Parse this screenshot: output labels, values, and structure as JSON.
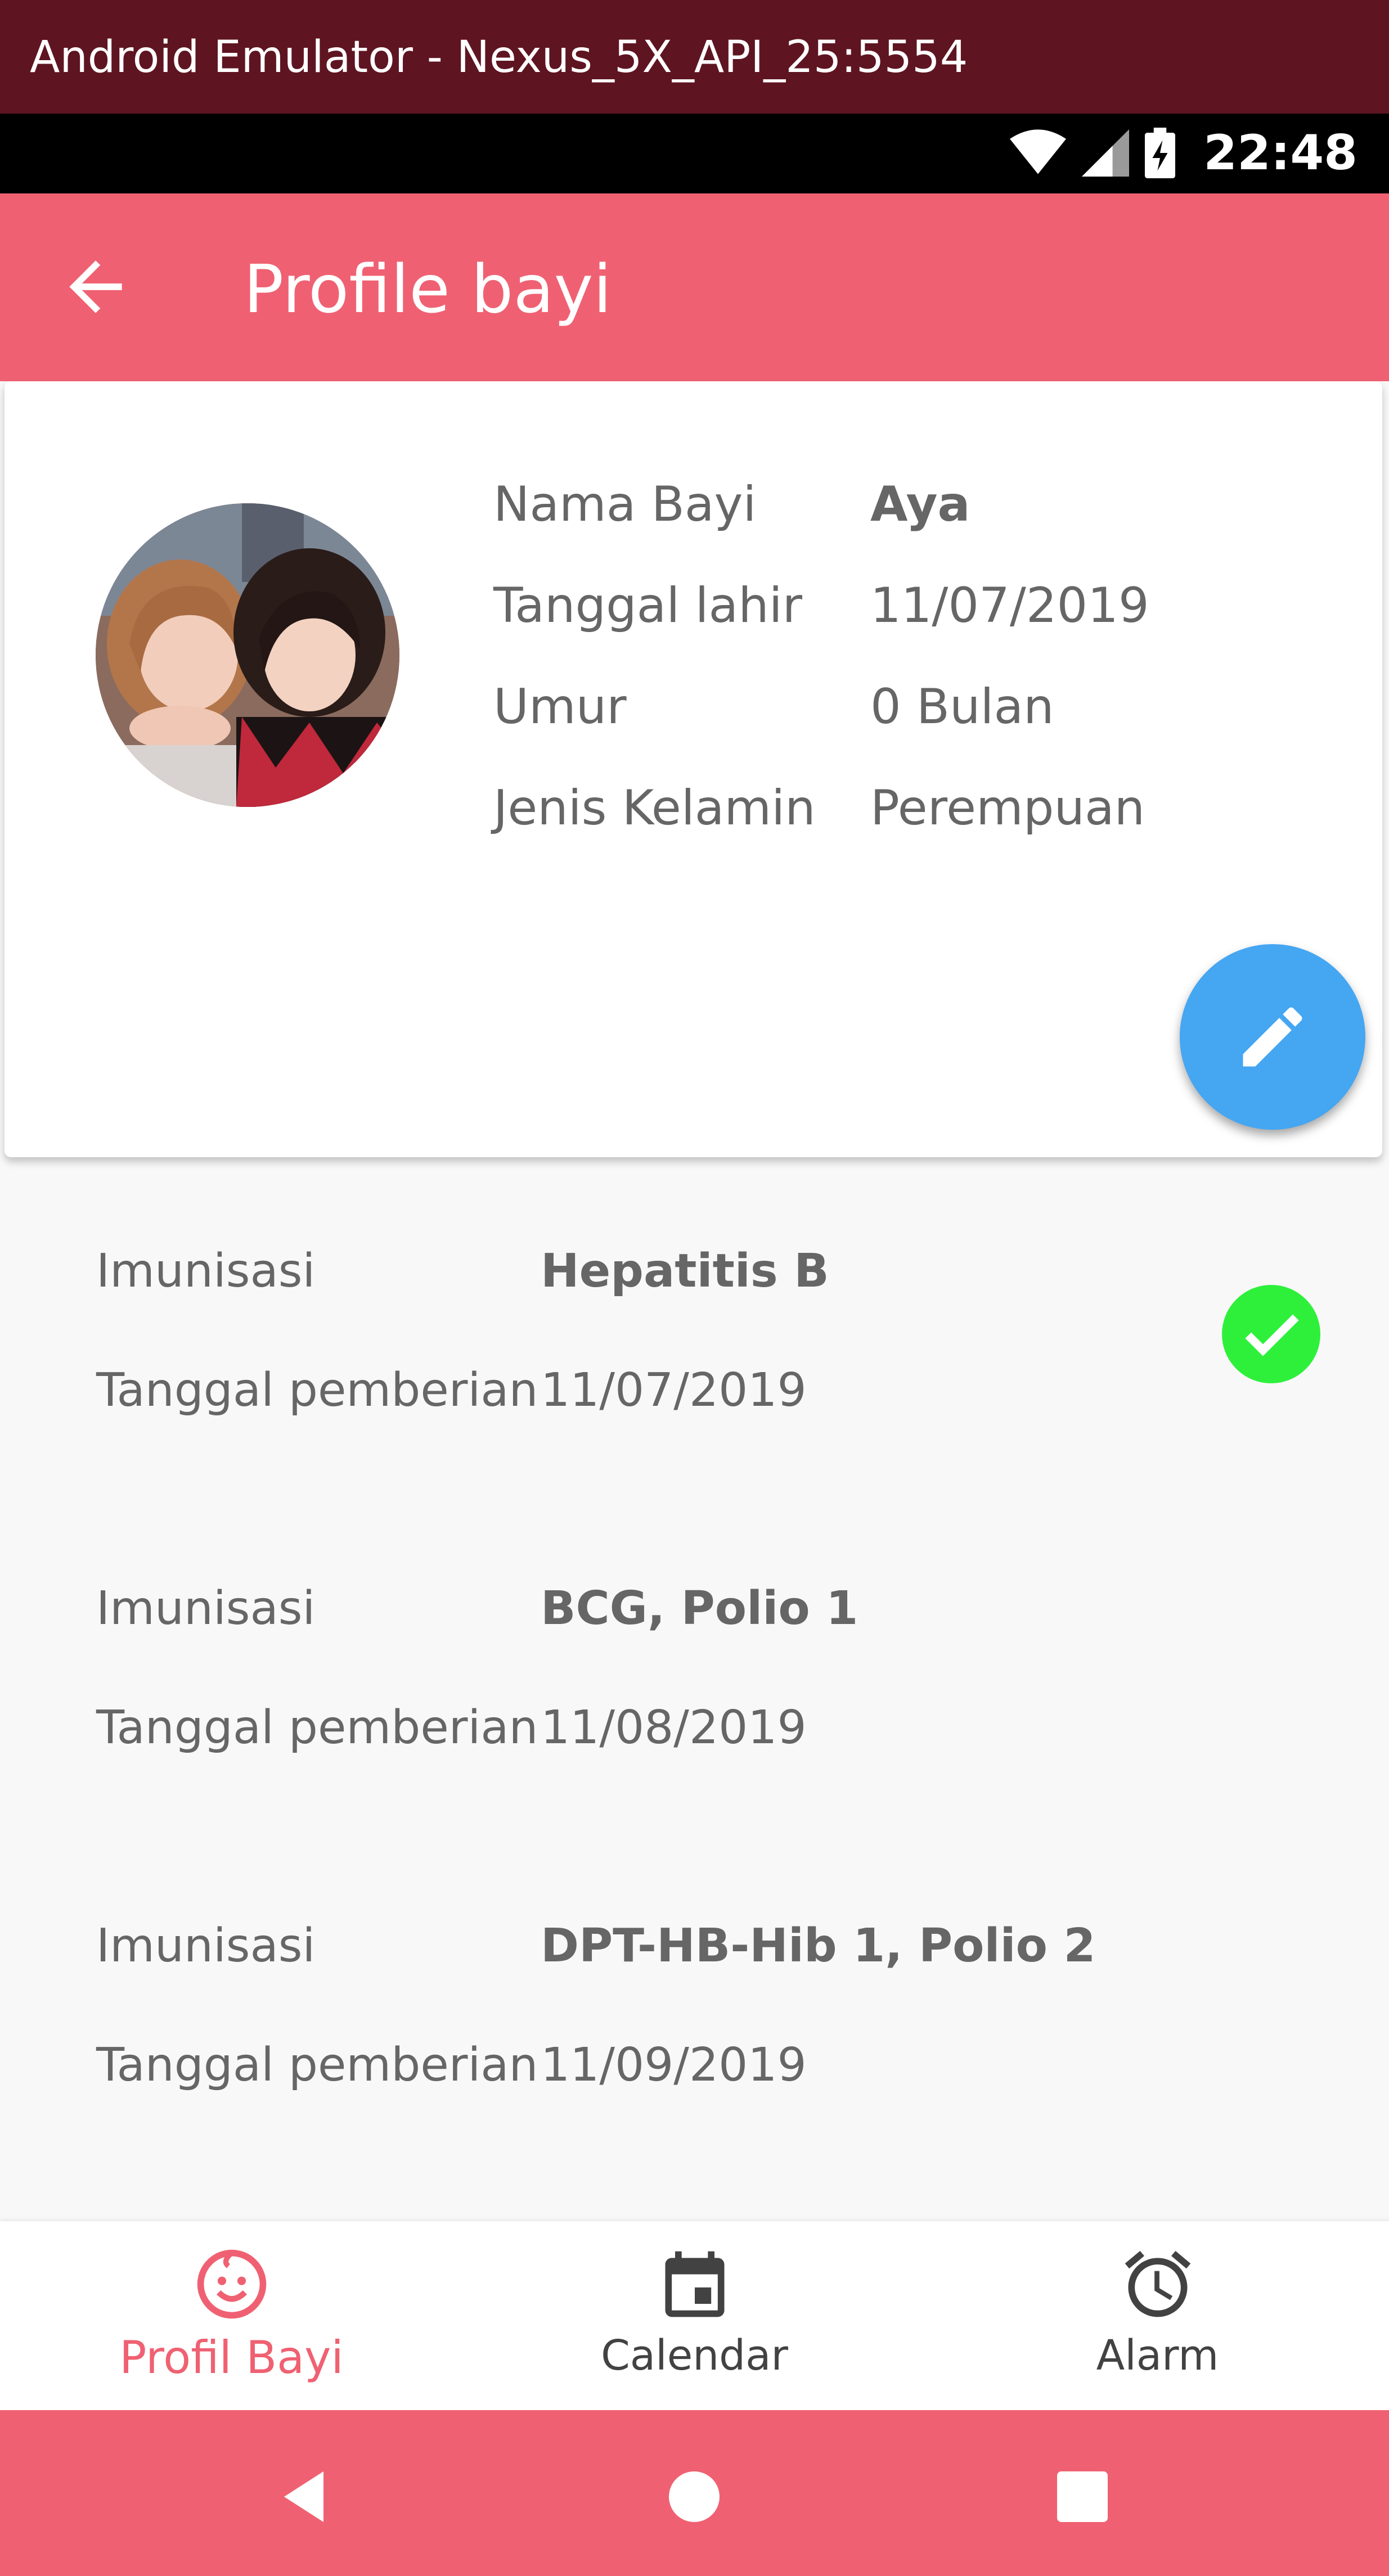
{
  "window": {
    "title": "Android Emulator - Nexus_5X_API_25:5554"
  },
  "status_bar": {
    "time": "22:48",
    "icons": [
      "wifi-icon",
      "signal-icon",
      "battery-charging-icon"
    ]
  },
  "app_bar": {
    "title": "Profile bayi",
    "back_icon": "arrow-back-icon"
  },
  "profile": {
    "rows": [
      {
        "label": "Nama Bayi",
        "value": "Aya"
      },
      {
        "label": "Tanggal lahir",
        "value": "11/07/2019"
      },
      {
        "label": "Umur",
        "value": "0 Bulan"
      },
      {
        "label": "Jenis Kelamin",
        "value": "Perempuan"
      }
    ],
    "edit_icon": "pencil-icon"
  },
  "immunizations": [
    {
      "label": "Imunisasi",
      "name": "Hepatitis B",
      "date_label": "Tanggal pemberian",
      "date": "11/07/2019",
      "done": true
    },
    {
      "label": "Imunisasi",
      "name": "BCG, Polio 1",
      "date_label": "Tanggal pemberian",
      "date": "11/08/2019",
      "done": false
    },
    {
      "label": "Imunisasi",
      "name": "DPT-HB-Hib 1, Polio 2",
      "date_label": "Tanggal pemberian",
      "date": "11/09/2019",
      "done": false
    }
  ],
  "bottom_nav": {
    "items": [
      {
        "label": "Profil Bayi",
        "icon": "baby-face-icon",
        "active": true
      },
      {
        "label": "Calendar",
        "icon": "calendar-icon",
        "active": false
      },
      {
        "label": "Alarm",
        "icon": "alarm-clock-icon",
        "active": false
      }
    ]
  },
  "colors": {
    "primary": "#ef6172",
    "window_bar": "#5e1521",
    "fab": "#45a6f2",
    "check": "#2ef03b",
    "text": "#666666",
    "nav_inactive": "#424242"
  }
}
